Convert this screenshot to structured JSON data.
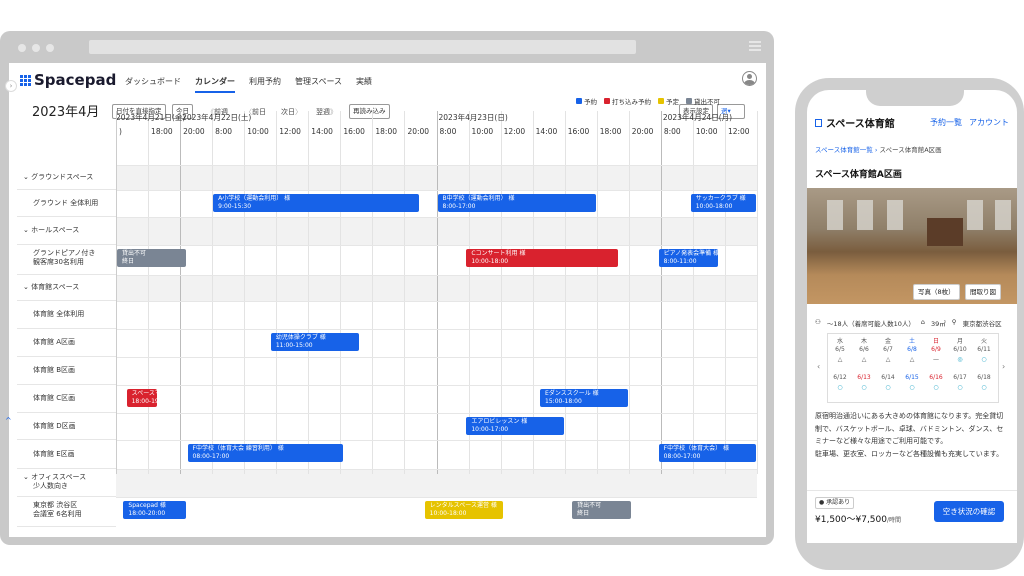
{
  "app": {
    "logo": "Spacepad",
    "nav": [
      "ダッシュボード",
      "カレンダー",
      "利用予約",
      "管理スペース",
      "実績"
    ],
    "active_nav": "カレンダー"
  },
  "toolbar": {
    "month": "2023年4月",
    "date_pick": "日付を直接指定",
    "today": "今日",
    "prev_week": "前週",
    "prev_day": "前日",
    "next_day": "次日",
    "next_week": "翌週",
    "reload": "再読み込み",
    "display_settings": "表示設定",
    "view_select": "週"
  },
  "legend": [
    {
      "label": "予約",
      "color": "#1762e8"
    },
    {
      "label": "打ち込み予約",
      "color": "#d9222e"
    },
    {
      "label": "予定",
      "color": "#e6c300"
    },
    {
      "label": "貸出不可",
      "color": "#7a8594"
    }
  ],
  "dates": [
    "2023年4月21日(金)",
    "2023年4月22日(土)",
    "2023年4月23日(日)",
    "2023年4月24日(月)"
  ],
  "times": [
    ")",
    "18:00",
    "20:00",
    "8:00",
    "10:00",
    "12:00",
    "14:00",
    "16:00",
    "18:00",
    "20:00",
    "8:00",
    "10:00",
    "12:00",
    "14:00",
    "16:00",
    "18:00",
    "20:00",
    "8:00",
    "10:00",
    "12:00"
  ],
  "rows": [
    {
      "label": "グラウンドスペース",
      "cat": true
    },
    {
      "label": "グラウンド 全体利用",
      "cat": false
    },
    {
      "label": "ホールスペース",
      "cat": true
    },
    {
      "label": "グランドピアノ付き\n観客席30名利用",
      "cat": false
    },
    {
      "label": "体育館スペース",
      "cat": true
    },
    {
      "label": "体育館 全体利用",
      "cat": false
    },
    {
      "label": "体育館 A区画",
      "cat": false
    },
    {
      "label": "体育館 B区画",
      "cat": false
    },
    {
      "label": "体育館 C区画",
      "cat": false
    },
    {
      "label": "体育館 D区画",
      "cat": false
    },
    {
      "label": "体育館 E区画",
      "cat": false
    },
    {
      "label": "オフィススペース\n少人数向き",
      "cat": true
    },
    {
      "label": "東京都 渋谷区\n会議室 6名利用",
      "cat": false
    }
  ],
  "events": [
    {
      "row": 1,
      "start": 3,
      "end": 9.5,
      "type": "予約",
      "title": "A小学校（運動会利用） 様",
      "time": "9:00-15:30"
    },
    {
      "row": 1,
      "start": 10,
      "end": 15,
      "type": "予約",
      "title": "B中学校（運動会利用） 様",
      "time": "8:00-17:00"
    },
    {
      "row": 1,
      "start": 17.9,
      "end": 20,
      "type": "予約",
      "title": "サッカークラブ 様",
      "time": "10:00-18:00"
    },
    {
      "row": 3,
      "start": 0,
      "end": 2.2,
      "type": "貸出不可",
      "title": "貸出不可",
      "time": "終日"
    },
    {
      "row": 3,
      "start": 10.9,
      "end": 15.7,
      "type": "打ち込み予約",
      "title": "Cコンサート利用 様",
      "time": "10:00-18:00"
    },
    {
      "row": 3,
      "start": 16.9,
      "end": 18.8,
      "type": "予約",
      "title": "ピアノ発表会準備 様",
      "time": "8:00-11:00"
    },
    {
      "row": 6,
      "start": 4.8,
      "end": 7.6,
      "type": "予約",
      "title": "幼児体操クラブ 様",
      "time": "11:00-15:00"
    },
    {
      "row": 8,
      "start": 0.3,
      "end": 1.3,
      "type": "打ち込み予約",
      "title": "スペースマ",
      "time": "18:00-19"
    },
    {
      "row": 8,
      "start": 13.2,
      "end": 16,
      "type": "予約",
      "title": "Eダンススクール 様",
      "time": "15:00-18:00"
    },
    {
      "row": 9,
      "start": 10.9,
      "end": 14,
      "type": "予約",
      "title": "エアロビレッスン 様",
      "time": "10:00-17:00"
    },
    {
      "row": 10,
      "start": 2.2,
      "end": 7.1,
      "type": "予約",
      "title": "F中学校（体育大会 練習利用） 様",
      "time": "08:00-17:00"
    },
    {
      "row": 10,
      "start": 16.9,
      "end": 20,
      "type": "予約",
      "title": "F中学校（体育大会） 様",
      "time": "08:00-17:00"
    },
    {
      "row": 12,
      "start": 0.2,
      "end": 2.2,
      "type": "予約",
      "title": "Spacepad 様",
      "time": "18:00-20:00"
    },
    {
      "row": 12,
      "start": 9.6,
      "end": 12.1,
      "type": "予定",
      "title": "レンタルスペース運営 様",
      "time": "10:00-18:00"
    },
    {
      "row": 12,
      "start": 14.2,
      "end": 16.1,
      "type": "貸出不可",
      "title": "貸出不可",
      "time": "終日"
    }
  ],
  "phone": {
    "title": "スペース体育館",
    "links": [
      "予約一覧",
      "アカウント"
    ],
    "crumb_link": "スペース体育館一覧",
    "crumb_current": "スペース体育館A区画",
    "heading": "スペース体育館A区画",
    "photo_btn": "写真（8枚）",
    "floor_btn": "間取り図",
    "capacity": "〜18人（着席可能人数10人）",
    "area": "39㎡",
    "location": "東京都渋谷区",
    "weekdays": [
      "水",
      "木",
      "金",
      "土",
      "日",
      "月",
      "火"
    ],
    "week1": [
      "6/5",
      "6/6",
      "6/7",
      "6/8",
      "6/9",
      "6/10",
      "6/11"
    ],
    "week1_marks": [
      "△",
      "△",
      "△",
      "△",
      "—",
      "◎",
      "○"
    ],
    "week2": [
      "6/12",
      "6/13",
      "6/14",
      "6/15",
      "6/16",
      "6/17",
      "6/18"
    ],
    "week2_marks": [
      "○",
      "○",
      "○",
      "○",
      "○",
      "○",
      "○"
    ],
    "description": "原宿明治通沿いにある大きめの体育館になります。完全貸切制で、バスケットボール、卓球、バドミントン、ダンス、セミナーなど様々な用途でご利用可能です。\n駐車場、更衣室、ロッカーなど各種設備も充実しています。",
    "badge": "承認あり",
    "price": "¥1,500〜¥7,500",
    "price_unit": "/時間",
    "cta": "空き状況の確認"
  }
}
